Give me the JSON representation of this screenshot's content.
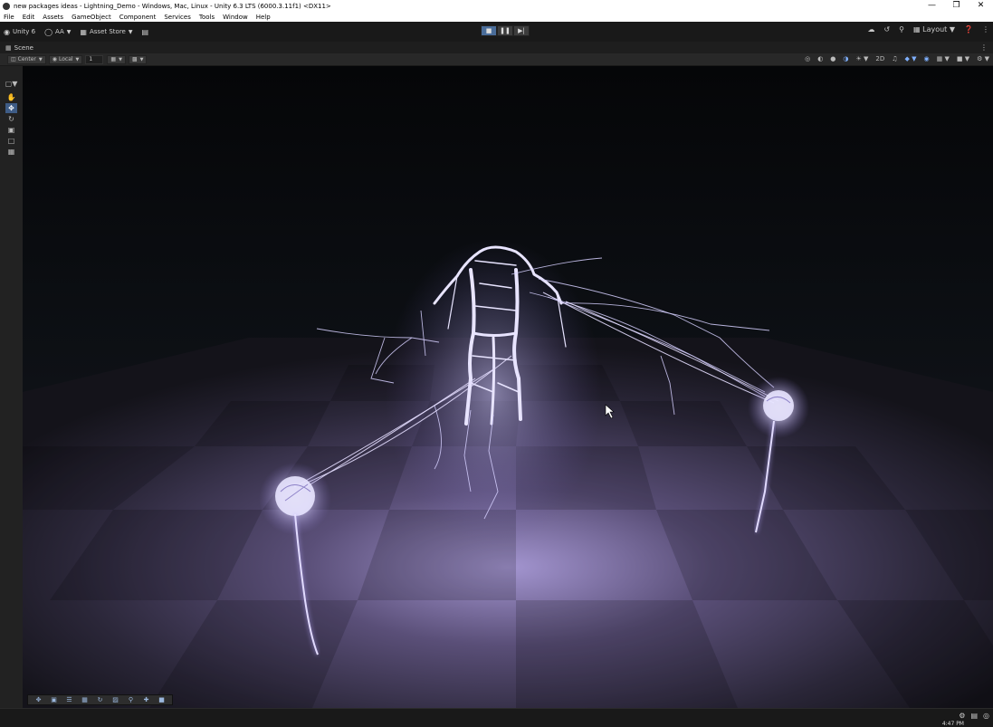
{
  "window": {
    "title": "new packages ideas - Lightning_Demo - Windows, Mac, Linux - Unity 6.3 LTS (6000.3.11f1) <DX11>",
    "controls": {
      "minimize": "—",
      "restore": "❐",
      "close": "✕"
    }
  },
  "menu": [
    "File",
    "Edit",
    "Assets",
    "GameObject",
    "Component",
    "Services",
    "Tools",
    "Window",
    "Help"
  ],
  "toolbar": {
    "unity_label": "Unity 6",
    "account_label": "AA",
    "asset_store_label": "Asset Store",
    "layout_label": "Layout",
    "play_state": "playing"
  },
  "scene_tab": {
    "label": "Scene"
  },
  "scene_toolbar": {
    "pivot_label": "Center",
    "space_label": "Local",
    "grid_value": "1"
  },
  "tools": {
    "active": "move",
    "items": [
      "view",
      "move",
      "rotate",
      "scale",
      "rect",
      "transform"
    ]
  },
  "colors": {
    "editor_bg": "#191919",
    "accent": "#4a6d9a",
    "lightning": "#e6e2ff",
    "floor_light": "#9a8cc4",
    "floor_dark": "#2a2438"
  },
  "statusbar": {
    "clock": "4:47 PM"
  }
}
